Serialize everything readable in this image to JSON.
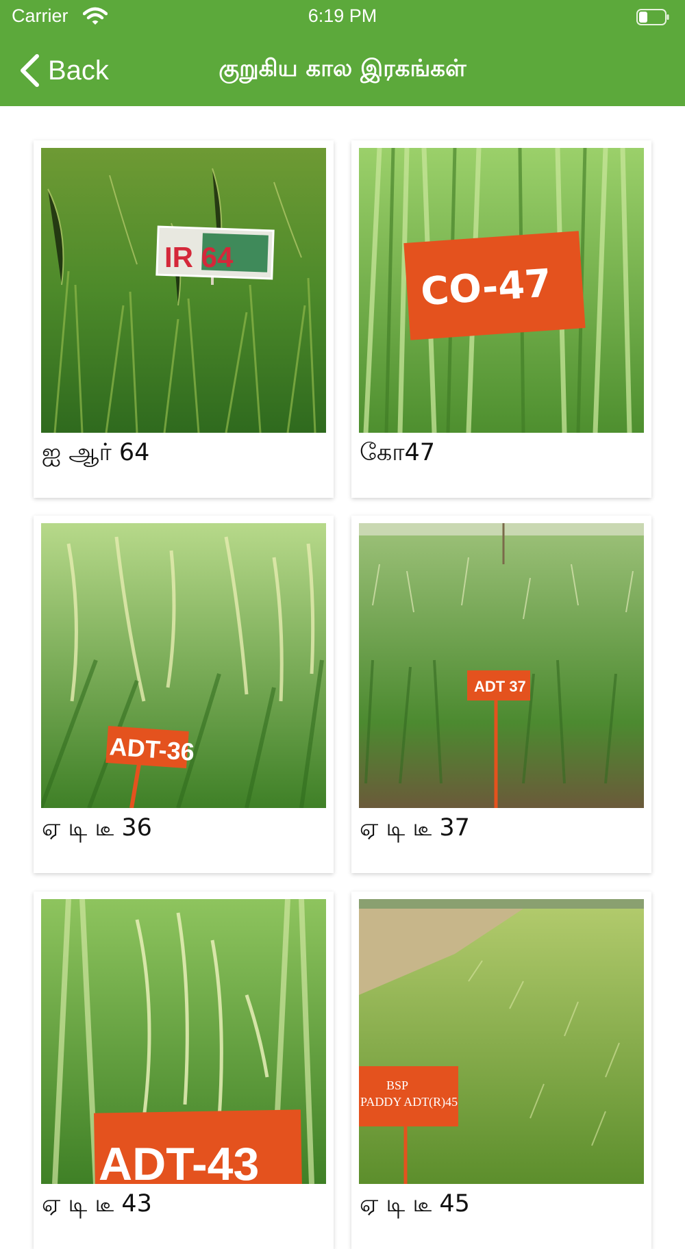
{
  "status": {
    "carrier": "Carrier",
    "time": "6:19 PM"
  },
  "nav": {
    "back_label": "Back",
    "title": "குறுகிய கால இரகங்கள்"
  },
  "varieties": [
    {
      "name": "ஐ ஆர் 64",
      "sign_text": "IR 64"
    },
    {
      "name": "கோ47",
      "sign_text": "CO-47"
    },
    {
      "name": "ஏ டி டீ 36",
      "sign_text": "ADT-36"
    },
    {
      "name": "ஏ டி டீ 37",
      "sign_text": "ADT 37"
    },
    {
      "name": "ஏ டி டீ 43",
      "sign_text": "ADT-43"
    },
    {
      "name": "ஏ டி டீ 45",
      "sign_text_1": "BSP",
      "sign_text_2": "PADDY ADT(R)45"
    }
  ],
  "colors": {
    "header_green": "#5ca93b",
    "sign_orange": "#e8541f"
  }
}
